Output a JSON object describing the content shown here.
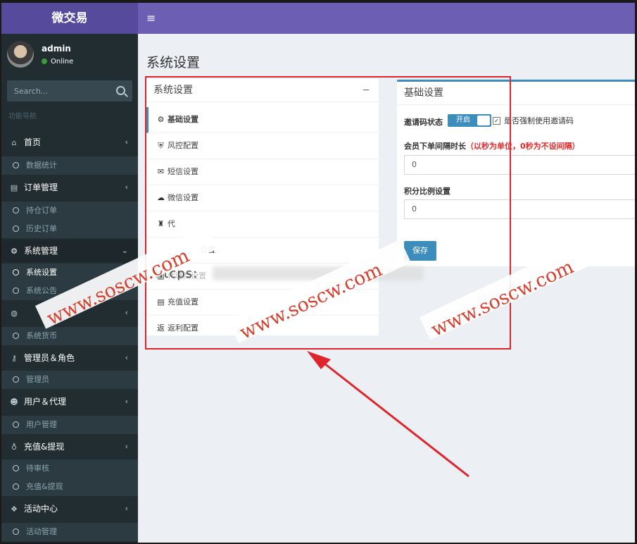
{
  "sidebar": {
    "logo": "微交易",
    "user_name": "admin",
    "user_status": "Online",
    "search_placeholder": "Search...",
    "nav_header": "功能导航",
    "menus": [
      {
        "label": "首页",
        "icon": "home-icon",
        "arrow": "‹"
      },
      {
        "label": "订单管理",
        "icon": "file-icon",
        "arrow": "‹"
      },
      {
        "label": "系统管理",
        "icon": "gear-icon",
        "arrow": "⌄"
      },
      {
        "label": "",
        "icon": "money-icon",
        "arrow": "‹"
      },
      {
        "label": "管理员＆角色",
        "icon": "key-icon",
        "arrow": "‹"
      },
      {
        "label": "用户＆代理",
        "icon": "users-icon",
        "arrow": "‹"
      },
      {
        "label": "充值&提现",
        "icon": "bag-icon",
        "arrow": "‹"
      },
      {
        "label": "活动中心",
        "icon": "gift-icon",
        "arrow": "‹"
      }
    ],
    "subs": {
      "dashboard": "数据统计",
      "positions": "持仓订单",
      "history": "历史订单",
      "system_settings": "系统设置",
      "system_notice": "系统公告",
      "system_currency": "系统货币",
      "admin": "管理员",
      "user_manage": "用户管理",
      "pending": "待审核",
      "recharge": "充值&提现",
      "activity": "活动管理"
    }
  },
  "header": {
    "menu_icon": "≡"
  },
  "page": {
    "title": "系统设置"
  },
  "settings_menu": {
    "title": "系统设置",
    "collapse": "−",
    "items": [
      {
        "label": "基础设置",
        "icon": "gear-icon",
        "glyph": "⚙"
      },
      {
        "label": "风控配置",
        "icon": "shield-icon",
        "glyph": "⛨"
      },
      {
        "label": "短信设置",
        "icon": "envelope-icon",
        "glyph": "✉"
      },
      {
        "label": "微信设置",
        "icon": "wechat-icon",
        "glyph": "☁"
      },
      {
        "label": "代",
        "icon": "agent-icon",
        "glyph": "♜"
      },
      {
        "label": "设置",
        "icon": "hidden-icon",
        "glyph": ""
      },
      {
        "label": "代理商设置",
        "icon": "chart-icon",
        "glyph": "▥"
      },
      {
        "label": "充值设置",
        "icon": "wallet-icon",
        "glyph": "▤"
      },
      {
        "label": "返利配置",
        "icon": "rebate-icon",
        "glyph": "返"
      }
    ]
  },
  "basic": {
    "title": "基础设置",
    "invite_label": "邀请码状态",
    "invite_toggle": "开启",
    "force_label": "是否强制使用邀请码",
    "interval_label": "会员下单间隔时长",
    "interval_hint": "（以秒为单位，0秒为不设间隔）",
    "interval_value": "0",
    "points_label": "积分比例设置",
    "points_value": "0",
    "save": "保存"
  },
  "watermark": {
    "text": "www.soscw.com",
    "overlay_text": "htcps:"
  },
  "colors": {
    "sidebar": "#222d32",
    "topbar": "#6c5fb3",
    "accent": "#3c8dbc",
    "highlight": "#e0242b"
  }
}
